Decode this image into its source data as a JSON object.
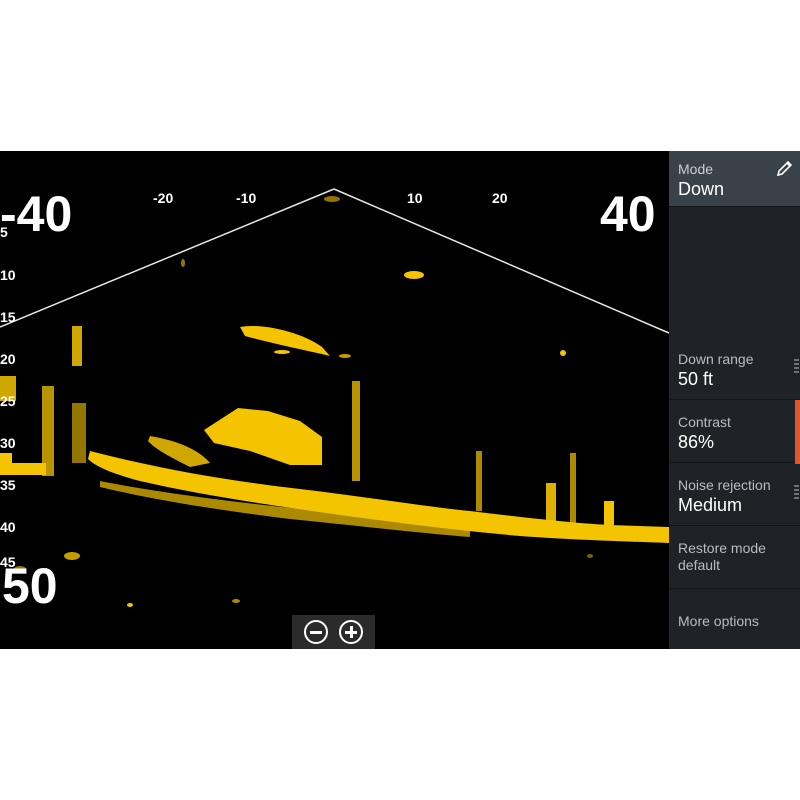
{
  "sonar": {
    "range_left": "-40",
    "range_right": "40",
    "depth_bottom": "50",
    "horizontal_ticks": [
      "-20",
      "-10",
      "10",
      "20"
    ],
    "depth_ticks": [
      "5",
      "10",
      "15",
      "20",
      "25",
      "30",
      "35",
      "40",
      "45"
    ],
    "echo_color": "#f5c400"
  },
  "zoom": {
    "out_icon": "minus-circle-icon",
    "in_icon": "plus-circle-icon"
  },
  "panel": {
    "mode": {
      "label": "Mode",
      "value": "Down",
      "edit_icon": "pencil-icon"
    },
    "down_range": {
      "label": "Down range",
      "value": "50 ft"
    },
    "contrast": {
      "label": "Contrast",
      "value": "86%",
      "level_percent": 86
    },
    "noise_rejection": {
      "label": "Noise rejection",
      "value": "Medium"
    },
    "restore_mode_default": {
      "line1": "Restore mode",
      "line2": "default"
    },
    "more_options": {
      "label": "More options"
    },
    "accent_color": "#e0562a"
  }
}
